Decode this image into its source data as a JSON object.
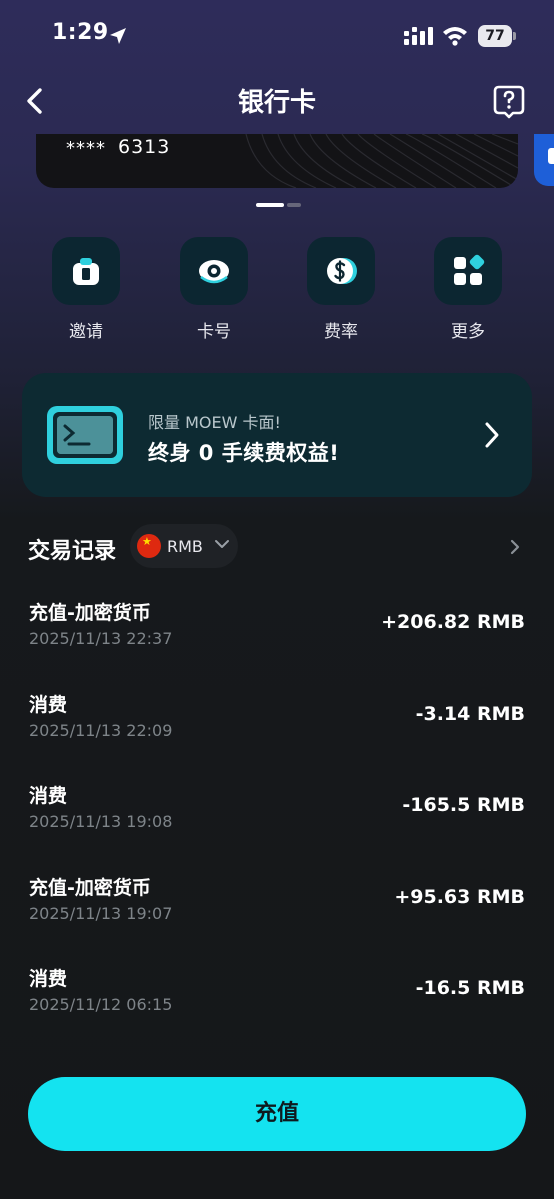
{
  "status_bar": {
    "time": "1:29",
    "battery": "77",
    "icons": [
      "location-arrow-icon",
      "cellular-signal-icon",
      "wifi-icon",
      "battery-icon"
    ]
  },
  "nav": {
    "title": "银行卡",
    "back_icon": "chevron-left-icon",
    "help_icon": "help-bubble-icon"
  },
  "card": {
    "masked": "****",
    "last4": "6313"
  },
  "quick_actions": [
    {
      "label": "邀请",
      "icon": "gift-icon"
    },
    {
      "label": "卡号",
      "icon": "eye-icon"
    },
    {
      "label": "费率",
      "icon": "dollar-coin-icon"
    },
    {
      "label": "更多",
      "icon": "grid-icon"
    }
  ],
  "promo": {
    "subtitle": "限量 MOEW 卡面!",
    "title": "终身 0 手续费权益!"
  },
  "transactions": {
    "title": "交易记录",
    "currency": "RMB",
    "items": [
      {
        "title": "充值-加密货币",
        "time": "2025/11/13 22:37",
        "amount": "+206.82 RMB"
      },
      {
        "title": "消费",
        "time": "2025/11/13 22:09",
        "amount": "-3.14 RMB"
      },
      {
        "title": "消费",
        "time": "2025/11/13 19:08",
        "amount": "-165.5 RMB"
      },
      {
        "title": "充值-加密货币",
        "time": "2025/11/13 19:07",
        "amount": "+95.63 RMB"
      },
      {
        "title": "消费",
        "time": "2025/11/12 06:15",
        "amount": "-16.5 RMB"
      }
    ]
  },
  "footer": {
    "topup_label": "充值"
  },
  "colors": {
    "accent": "#14e3f0",
    "tile_bg": "#0c2631",
    "promo_bg": "#0d2a32",
    "secondary_text": "#7e8489"
  }
}
